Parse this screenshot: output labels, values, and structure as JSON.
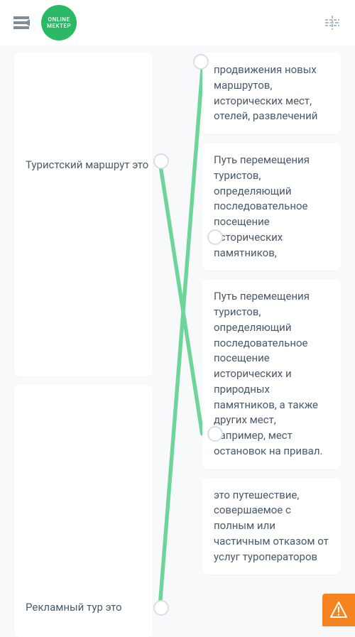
{
  "header": {
    "logo_line1": "ONLINE",
    "logo_line2": "MEKTEP"
  },
  "left": [
    {
      "text": "Туристский маршрут это"
    },
    {
      "text": "Рекламный тур это"
    }
  ],
  "right": [
    {
      "text": "продвижения новых маршрутов, исторических мест, отелей, развлечений"
    },
    {
      "text": "Путь перемещения туристов, определяющий последовательное посещение исторических памятников,"
    },
    {
      "text": "Путь перемещения туристов, определяющий последовательное посещение исторических и природных памятников, а также других мест, например, мест остановок на привал."
    },
    {
      "text": "это путешествие, совершаемое с полным или частичным отказом от услуг туроператоров"
    }
  ],
  "colors": {
    "accent": "#6ed59a",
    "warn": "#f5831f"
  }
}
